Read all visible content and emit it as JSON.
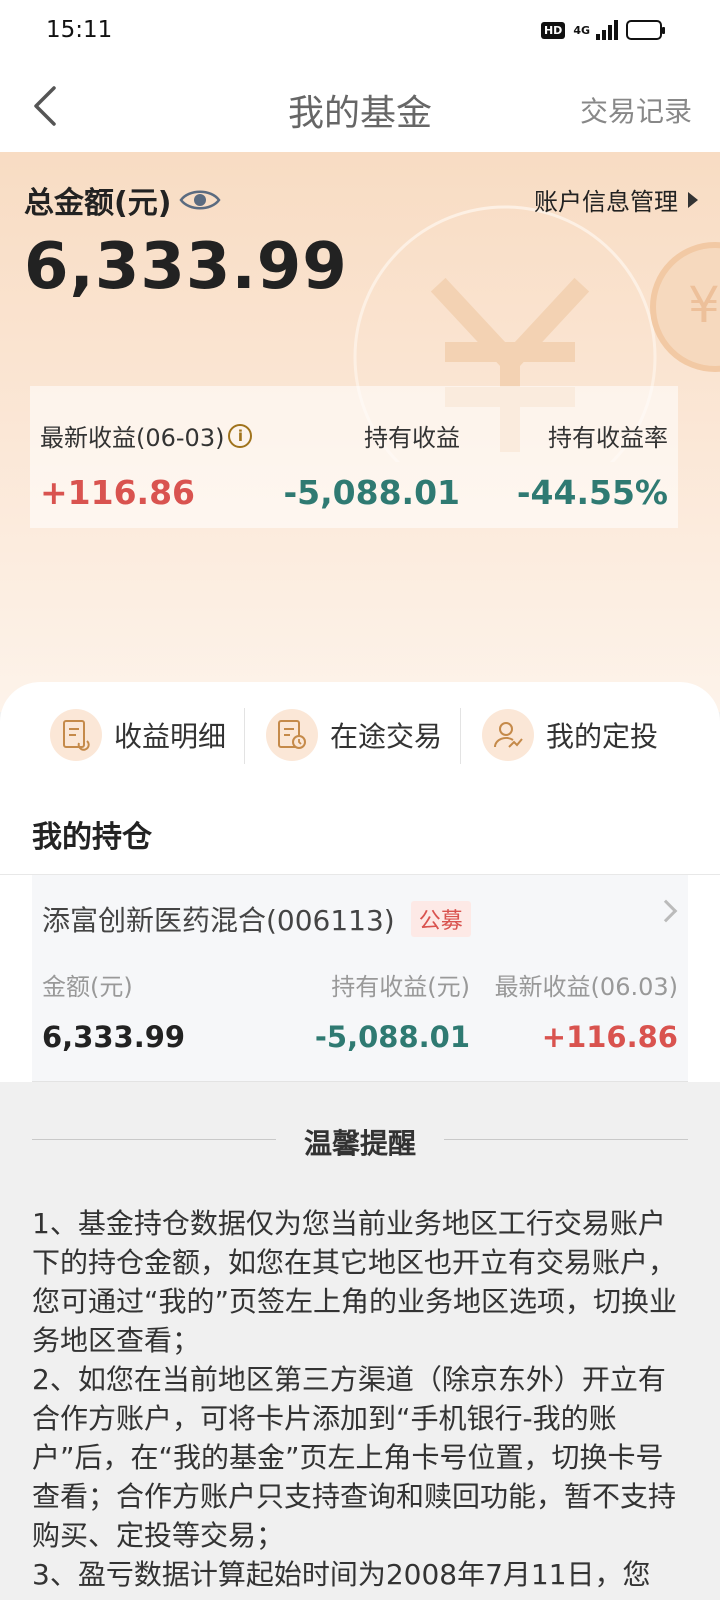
{
  "status_bar": {
    "time": "15:11",
    "hd_label": "HD",
    "network": "4G"
  },
  "navbar": {
    "title": "我的基金",
    "right_action": "交易记录"
  },
  "summary": {
    "total_label": "总金额(元)",
    "account_link": "账户信息管理",
    "total_amount": "6,333.99",
    "deco_symbol": "¥",
    "stats": [
      {
        "label": "最新收益(06-03)",
        "value": "+116.86",
        "color": "#d9534f"
      },
      {
        "label": "持有收益",
        "value": "-5,088.01",
        "color": "#2f7a72"
      },
      {
        "label": "持有收益率",
        "value": "-44.55%",
        "color": "#2f7a72"
      }
    ]
  },
  "quick_actions": [
    {
      "label": "收益明细",
      "icon": "document-icon"
    },
    {
      "label": "在途交易",
      "icon": "clock-document-icon"
    },
    {
      "label": "我的定投",
      "icon": "user-trend-icon"
    }
  ],
  "holdings": {
    "title": "我的持仓",
    "funds": [
      {
        "name": "添富创新医药混合(006113)",
        "badge": "公募",
        "columns": [
          {
            "label": "金额(元)",
            "value": "6,333.99"
          },
          {
            "label": "持有收益(元)",
            "value": "-5,088.01"
          },
          {
            "label": "最新收益(06.03)",
            "value": "+116.86"
          }
        ]
      }
    ]
  },
  "notice": {
    "title": "温馨提醒",
    "paragraphs": [
      "1、基金持仓数据仅为您当前业务地区工行交易账户下的持仓金额，如您在其它地区也开立有交易账户，您可通过“我的”页签左上角的业务地区选项，切换业务地区查看；",
      "2、如您在当前地区第三方渠道（除京东外）开立有合作方账户，可将卡片添加到“手机银行-我的账户”后，在“我的基金”页左上角卡号位置，切换卡号查看；合作方账户只支持查询和赎回功能，暂不支持购买、定投等交易；",
      "3、盈亏数据计算起始时间为2008年7月11日，您"
    ]
  },
  "colors": {
    "gain": "#d9534f",
    "loss": "#2f7a72",
    "accent": "#a0731c"
  }
}
